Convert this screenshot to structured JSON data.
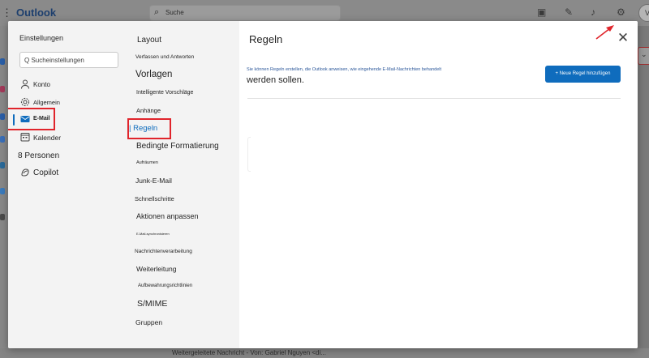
{
  "app": {
    "dots": "⋮",
    "name": "Outlook",
    "search_placeholder": "Suche",
    "avatar_initial": "V"
  },
  "settings": {
    "title": "Einstellungen",
    "search_placeholder": "Q Sucheinstellungen",
    "nav": [
      {
        "label": "Konto",
        "icon": "person-icon"
      },
      {
        "label": "Allgemein",
        "icon": "gear-icon"
      },
      {
        "label": "E-Mail",
        "icon": "mail-icon",
        "selected": true
      },
      {
        "label": "Kalender",
        "icon": "calendar-icon"
      },
      {
        "label": "8 Personen",
        "icon": ""
      },
      {
        "label": "Copilot",
        "icon": "copilot-icon"
      }
    ]
  },
  "mail_nav": [
    {
      "label": "Layout"
    },
    {
      "label": "Verfassen und Antworten"
    },
    {
      "label": "Vorlagen"
    },
    {
      "label": "Intelligente Vorschläge"
    },
    {
      "label": "Anhänge"
    },
    {
      "label": "| Regeln",
      "selected": true
    },
    {
      "label": "Bedingte Formatierung"
    },
    {
      "label": "Aufräumen"
    },
    {
      "label": "Junk-E-Mail"
    },
    {
      "label": "Schnellschritte"
    },
    {
      "label": "Aktionen anpassen"
    },
    {
      "label": "E-Mail-synchronisieren"
    },
    {
      "label": "Nachrichtenverarbeitung"
    },
    {
      "label": "Weiterleitung"
    },
    {
      "label": "Aufbewahrungsrichtlinien"
    },
    {
      "label": "S/MIME"
    },
    {
      "label": "Gruppen"
    }
  ],
  "rules_panel": {
    "title": "Regeln",
    "close_glyph": "✕",
    "description_small": "Sie können Regeln erstellen, die Outlook anweisen, wie eingehende E-Mail-Nachrichten behandelt",
    "description_large": "werden sollen.",
    "new_rule_button": "+ Neue Regel hinzufügen"
  },
  "background": {
    "bottom_text": "Weitergeleitete Nachricht - Von: Gabriel Nguyen <di..."
  },
  "colors": {
    "accent": "#0f6cbd",
    "annotation": "#e0242b",
    "overlay": "#7a7a7a"
  }
}
